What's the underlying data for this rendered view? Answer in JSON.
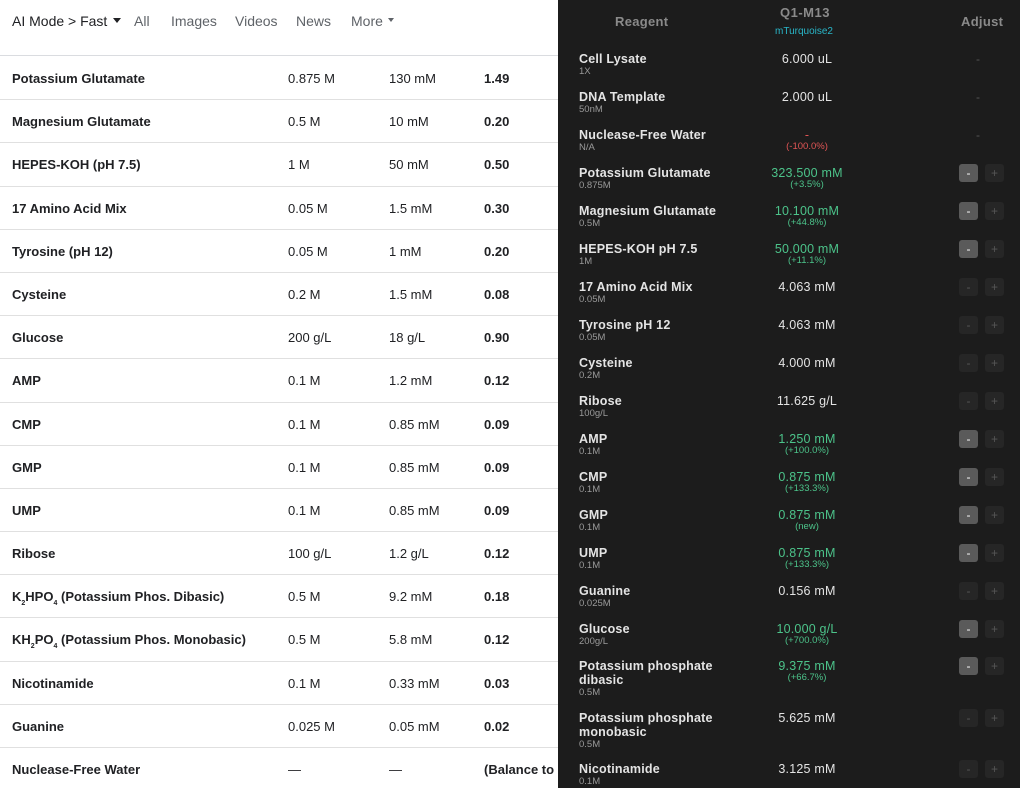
{
  "nav": {
    "mode": "AI Mode > Fast",
    "tabs": [
      "All",
      "Images",
      "Videos",
      "News"
    ],
    "more": "More"
  },
  "left_table": [
    {
      "name": "Potassium Glutamate",
      "stock": "0.875 M",
      "final": "130 mM",
      "volume": "1.49"
    },
    {
      "name": "Magnesium Glutamate",
      "stock": "0.5 M",
      "final": "10 mM",
      "volume": "0.20"
    },
    {
      "name": "HEPES-KOH (pH 7.5)",
      "stock": "1 M",
      "final": "50 mM",
      "volume": "0.50"
    },
    {
      "name": "17 Amino Acid Mix",
      "stock": "0.05 M",
      "final": "1.5 mM",
      "volume": "0.30"
    },
    {
      "name": "Tyrosine (pH 12)",
      "stock": "0.05 M",
      "final": "1 mM",
      "volume": "0.20"
    },
    {
      "name": "Cysteine",
      "stock": "0.2 M",
      "final": "1.5 mM",
      "volume": "0.08"
    },
    {
      "name": "Glucose",
      "stock": "200 g/L",
      "final": "18 g/L",
      "volume": "0.90"
    },
    {
      "name": "AMP",
      "stock": "0.1 M",
      "final": "1.2 mM",
      "volume": "0.12"
    },
    {
      "name": "CMP",
      "stock": "0.1 M",
      "final": "0.85 mM",
      "volume": "0.09"
    },
    {
      "name": "GMP",
      "stock": "0.1 M",
      "final": "0.85 mM",
      "volume": "0.09"
    },
    {
      "name": "UMP",
      "stock": "0.1 M",
      "final": "0.85 mM",
      "volume": "0.09"
    },
    {
      "name": "Ribose",
      "stock": "100 g/L",
      "final": "1.2 g/L",
      "volume": "0.12"
    },
    {
      "name_parts": [
        "K",
        "2",
        "HPO",
        "4",
        " (Potassium Phos. Dibasic)"
      ],
      "stock": "0.5 M",
      "final": "9.2 mM",
      "volume": "0.18"
    },
    {
      "name_parts": [
        "KH",
        "2",
        "PO",
        "4",
        " (Potassium Phos. Monobasic)"
      ],
      "stock": "0.5 M",
      "final": "5.8 mM",
      "volume": "0.12"
    },
    {
      "name": "Nicotinamide",
      "stock": "0.1 M",
      "final": "0.33 mM",
      "volume": "0.03"
    },
    {
      "name": "Guanine",
      "stock": "0.025 M",
      "final": "0.05 mM",
      "volume": "0.02"
    },
    {
      "name": "Nuclease-Free Water",
      "stock": "—",
      "final": "—",
      "volume": "(Balance to"
    }
  ],
  "right_panel": {
    "header": {
      "reagent": "Reagent",
      "column": "Q1-M13",
      "column_sub": "mTurquoise2",
      "adjust": "Adjust"
    },
    "colors": {
      "background": "#1c1c1c",
      "increase": "#4cc38a",
      "decrease": "#e05555",
      "accent": "#29b6c8"
    },
    "rows": [
      {
        "name": "Cell Lysate",
        "stock": "1X",
        "value": "6.000 uL",
        "delta": "",
        "trend": "none",
        "adjust": "dash"
      },
      {
        "name": "DNA Template",
        "stock": "50nM",
        "value": "2.000 uL",
        "delta": "",
        "trend": "none",
        "adjust": "dash"
      },
      {
        "name": "Nuclease-Free Water",
        "stock": "N/A",
        "value": "-",
        "delta": "(-100.0%)",
        "trend": "down",
        "adjust": "dash"
      },
      {
        "name": "Potassium Glutamate",
        "stock": "0.875M",
        "value": "323.500 mM",
        "delta": "(+3.5%)",
        "trend": "up",
        "adjust": "minus"
      },
      {
        "name": "Magnesium Glutamate",
        "stock": "0.5M",
        "value": "10.100 mM",
        "delta": "(+44.8%)",
        "trend": "up",
        "adjust": "minus"
      },
      {
        "name": "HEPES-KOH pH 7.5",
        "stock": "1M",
        "value": "50.000 mM",
        "delta": "(+11.1%)",
        "trend": "up",
        "adjust": "minus"
      },
      {
        "name": "17 Amino Acid Mix",
        "stock": "0.05M",
        "value": "4.063 mM",
        "delta": "",
        "trend": "none",
        "adjust": "none"
      },
      {
        "name": "Tyrosine pH 12",
        "stock": "0.05M",
        "value": "4.063 mM",
        "delta": "",
        "trend": "none",
        "adjust": "none"
      },
      {
        "name": "Cysteine",
        "stock": "0.2M",
        "value": "4.000 mM",
        "delta": "",
        "trend": "none",
        "adjust": "none"
      },
      {
        "name": "Ribose",
        "stock": "100g/L",
        "value": "11.625 g/L",
        "delta": "",
        "trend": "none",
        "adjust": "none"
      },
      {
        "name": "AMP",
        "stock": "0.1M",
        "value": "1.250 mM",
        "delta": "(+100.0%)",
        "trend": "up",
        "adjust": "minus"
      },
      {
        "name": "CMP",
        "stock": "0.1M",
        "value": "0.875 mM",
        "delta": "(+133.3%)",
        "trend": "up",
        "adjust": "minus"
      },
      {
        "name": "GMP",
        "stock": "0.1M",
        "value": "0.875 mM",
        "delta": "(new)",
        "trend": "up",
        "adjust": "minus"
      },
      {
        "name": "UMP",
        "stock": "0.1M",
        "value": "0.875 mM",
        "delta": "(+133.3%)",
        "trend": "up",
        "adjust": "minus"
      },
      {
        "name": "Guanine",
        "stock": "0.025M",
        "value": "0.156 mM",
        "delta": "",
        "trend": "none",
        "adjust": "none"
      },
      {
        "name": "Glucose",
        "stock": "200g/L",
        "value": "10.000 g/L",
        "delta": "(+700.0%)",
        "trend": "up",
        "adjust": "minus"
      },
      {
        "name": "Potassium phosphate dibasic",
        "stock": "0.5M",
        "value": "9.375 mM",
        "delta": "(+66.7%)",
        "trend": "up",
        "adjust": "minus"
      },
      {
        "name": "Potassium phosphate monobasic",
        "stock": "0.5M",
        "value": "5.625 mM",
        "delta": "",
        "trend": "none",
        "adjust": "none"
      },
      {
        "name": "Nicotinamide",
        "stock": "0.1M",
        "value": "3.125 mM",
        "delta": "",
        "trend": "none",
        "adjust": "none"
      }
    ],
    "btn_minus": "-",
    "btn_plus": "+",
    "dash": "-"
  }
}
